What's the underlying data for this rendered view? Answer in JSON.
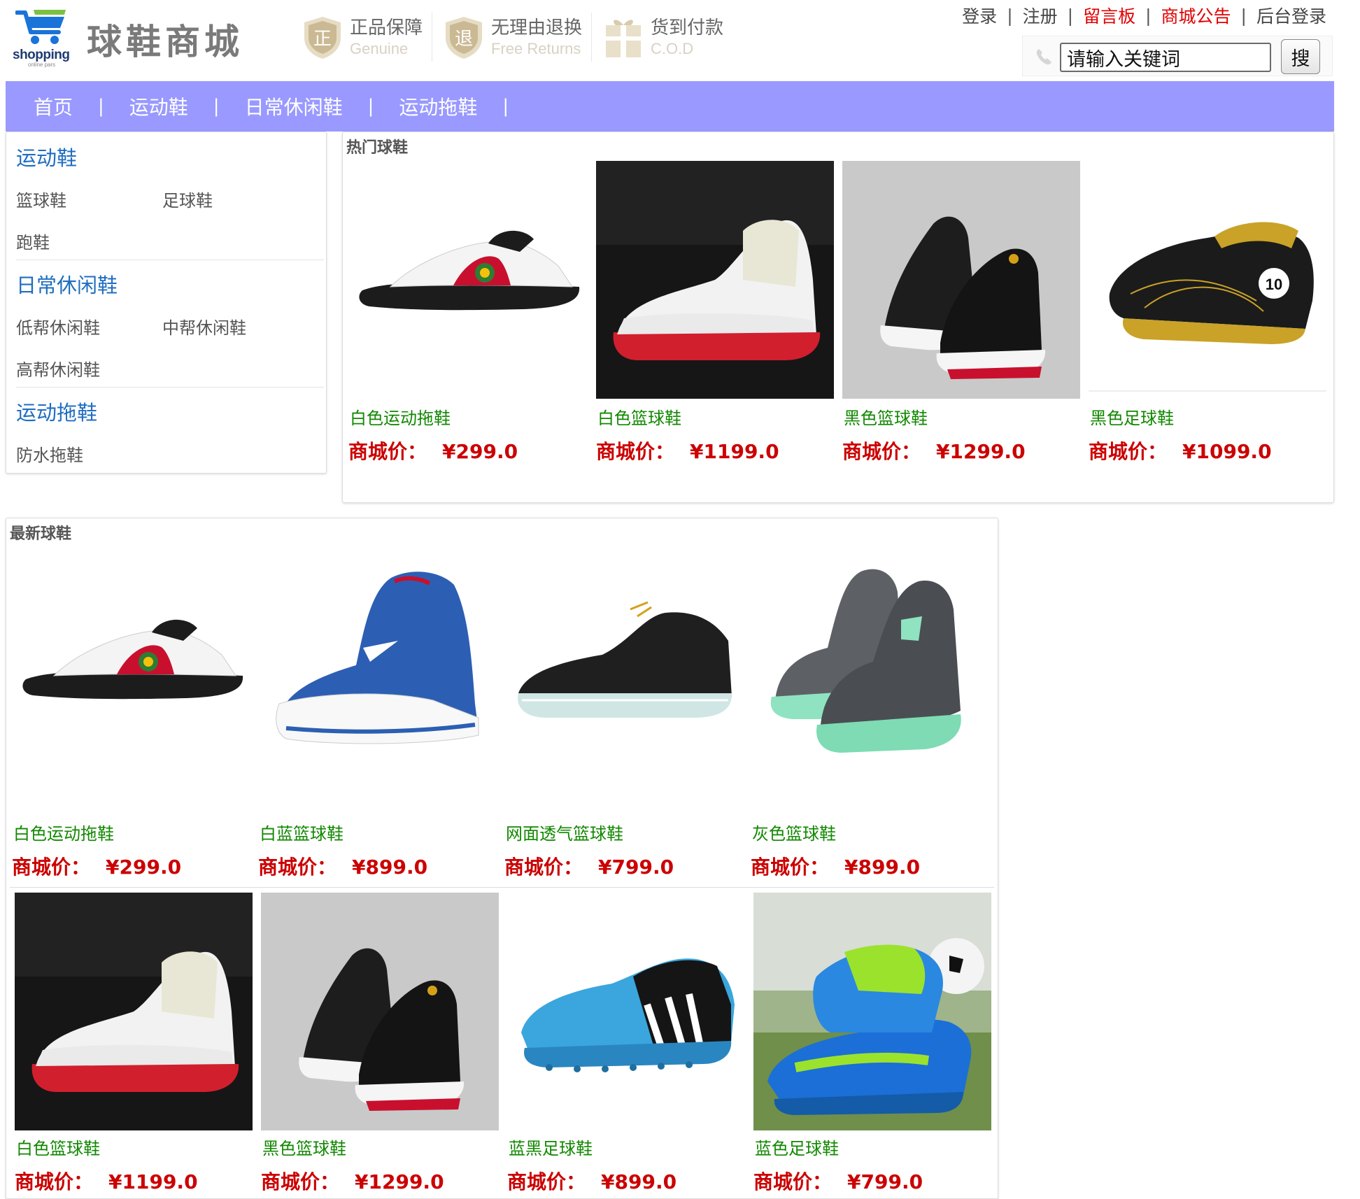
{
  "brand": {
    "logo_word": "shopping",
    "logo_sub": "online pars",
    "site_name": "球鞋商城"
  },
  "guarantees": [
    {
      "icon": "shield-zheng-icon",
      "badge_char": "正",
      "cn": "正品保障",
      "en": "Genuine"
    },
    {
      "icon": "shield-tui-icon",
      "badge_char": "退",
      "cn": "无理由退换",
      "en": "Free Returns"
    },
    {
      "icon": "gift-box-icon",
      "badge_char": "",
      "cn": "货到付款",
      "en": "C.O.D"
    }
  ],
  "top_links": [
    {
      "label": "登录",
      "color": "#444444"
    },
    {
      "label": "注册",
      "color": "#444444"
    },
    {
      "label": "留言板",
      "color": "#e00000"
    },
    {
      "label": "商城公告",
      "color": "#e00000"
    },
    {
      "label": "后台登录",
      "color": "#444444"
    }
  ],
  "search": {
    "value": "请输入关键词",
    "button_label": "搜",
    "icon": "phone-icon"
  },
  "nav": {
    "items": [
      "首页",
      "运动鞋",
      "日常休闲鞋",
      "运动拖鞋"
    ],
    "separator": "|",
    "background": "#9999ff"
  },
  "sidebar": {
    "categories": [
      {
        "title": "运动鞋",
        "subs": [
          "篮球鞋",
          "足球鞋",
          "跑鞋"
        ]
      },
      {
        "title": "日常休闲鞋",
        "subs": [
          "低帮休闲鞋",
          "中帮休闲鞋",
          "高帮休闲鞋"
        ]
      },
      {
        "title": "运动拖鞋",
        "subs": [
          "防水拖鞋"
        ]
      }
    ]
  },
  "price_label": "商城价：",
  "hot": {
    "title": "热门球鞋",
    "products": [
      {
        "name": "白色运动拖鞋",
        "price": "¥299.0",
        "image": "white-red-slide"
      },
      {
        "name": "白色篮球鞋",
        "price": "¥1199.0",
        "image": "white-lowtop-red-sole"
      },
      {
        "name": "黑色篮球鞋",
        "price": "¥1299.0",
        "image": "black-basketball-pair"
      },
      {
        "name": "黑色足球鞋",
        "price": "¥1099.0",
        "image": "black-gold-soccer"
      }
    ]
  },
  "newest": {
    "title": "最新球鞋",
    "products": [
      {
        "name": "白色运动拖鞋",
        "price": "¥299.0",
        "image": "white-red-slide"
      },
      {
        "name": "白蓝篮球鞋",
        "price": "¥899.0",
        "image": "white-blue-hightop"
      },
      {
        "name": "网面透气篮球鞋",
        "price": "¥799.0",
        "image": "black-knit"
      },
      {
        "name": "灰色篮球鞋",
        "price": "¥899.0",
        "image": "grey-mint-hightop"
      },
      {
        "name": "白色篮球鞋",
        "price": "¥1199.0",
        "image": "white-lowtop-red-sole"
      },
      {
        "name": "黑色篮球鞋",
        "price": "¥1299.0",
        "image": "black-basketball-pair"
      },
      {
        "name": "蓝黑足球鞋",
        "price": "¥899.0",
        "image": "blue-black-soccer"
      },
      {
        "name": "蓝色足球鞋",
        "price": "¥799.0",
        "image": "blue-green-soccer-pair"
      }
    ]
  }
}
